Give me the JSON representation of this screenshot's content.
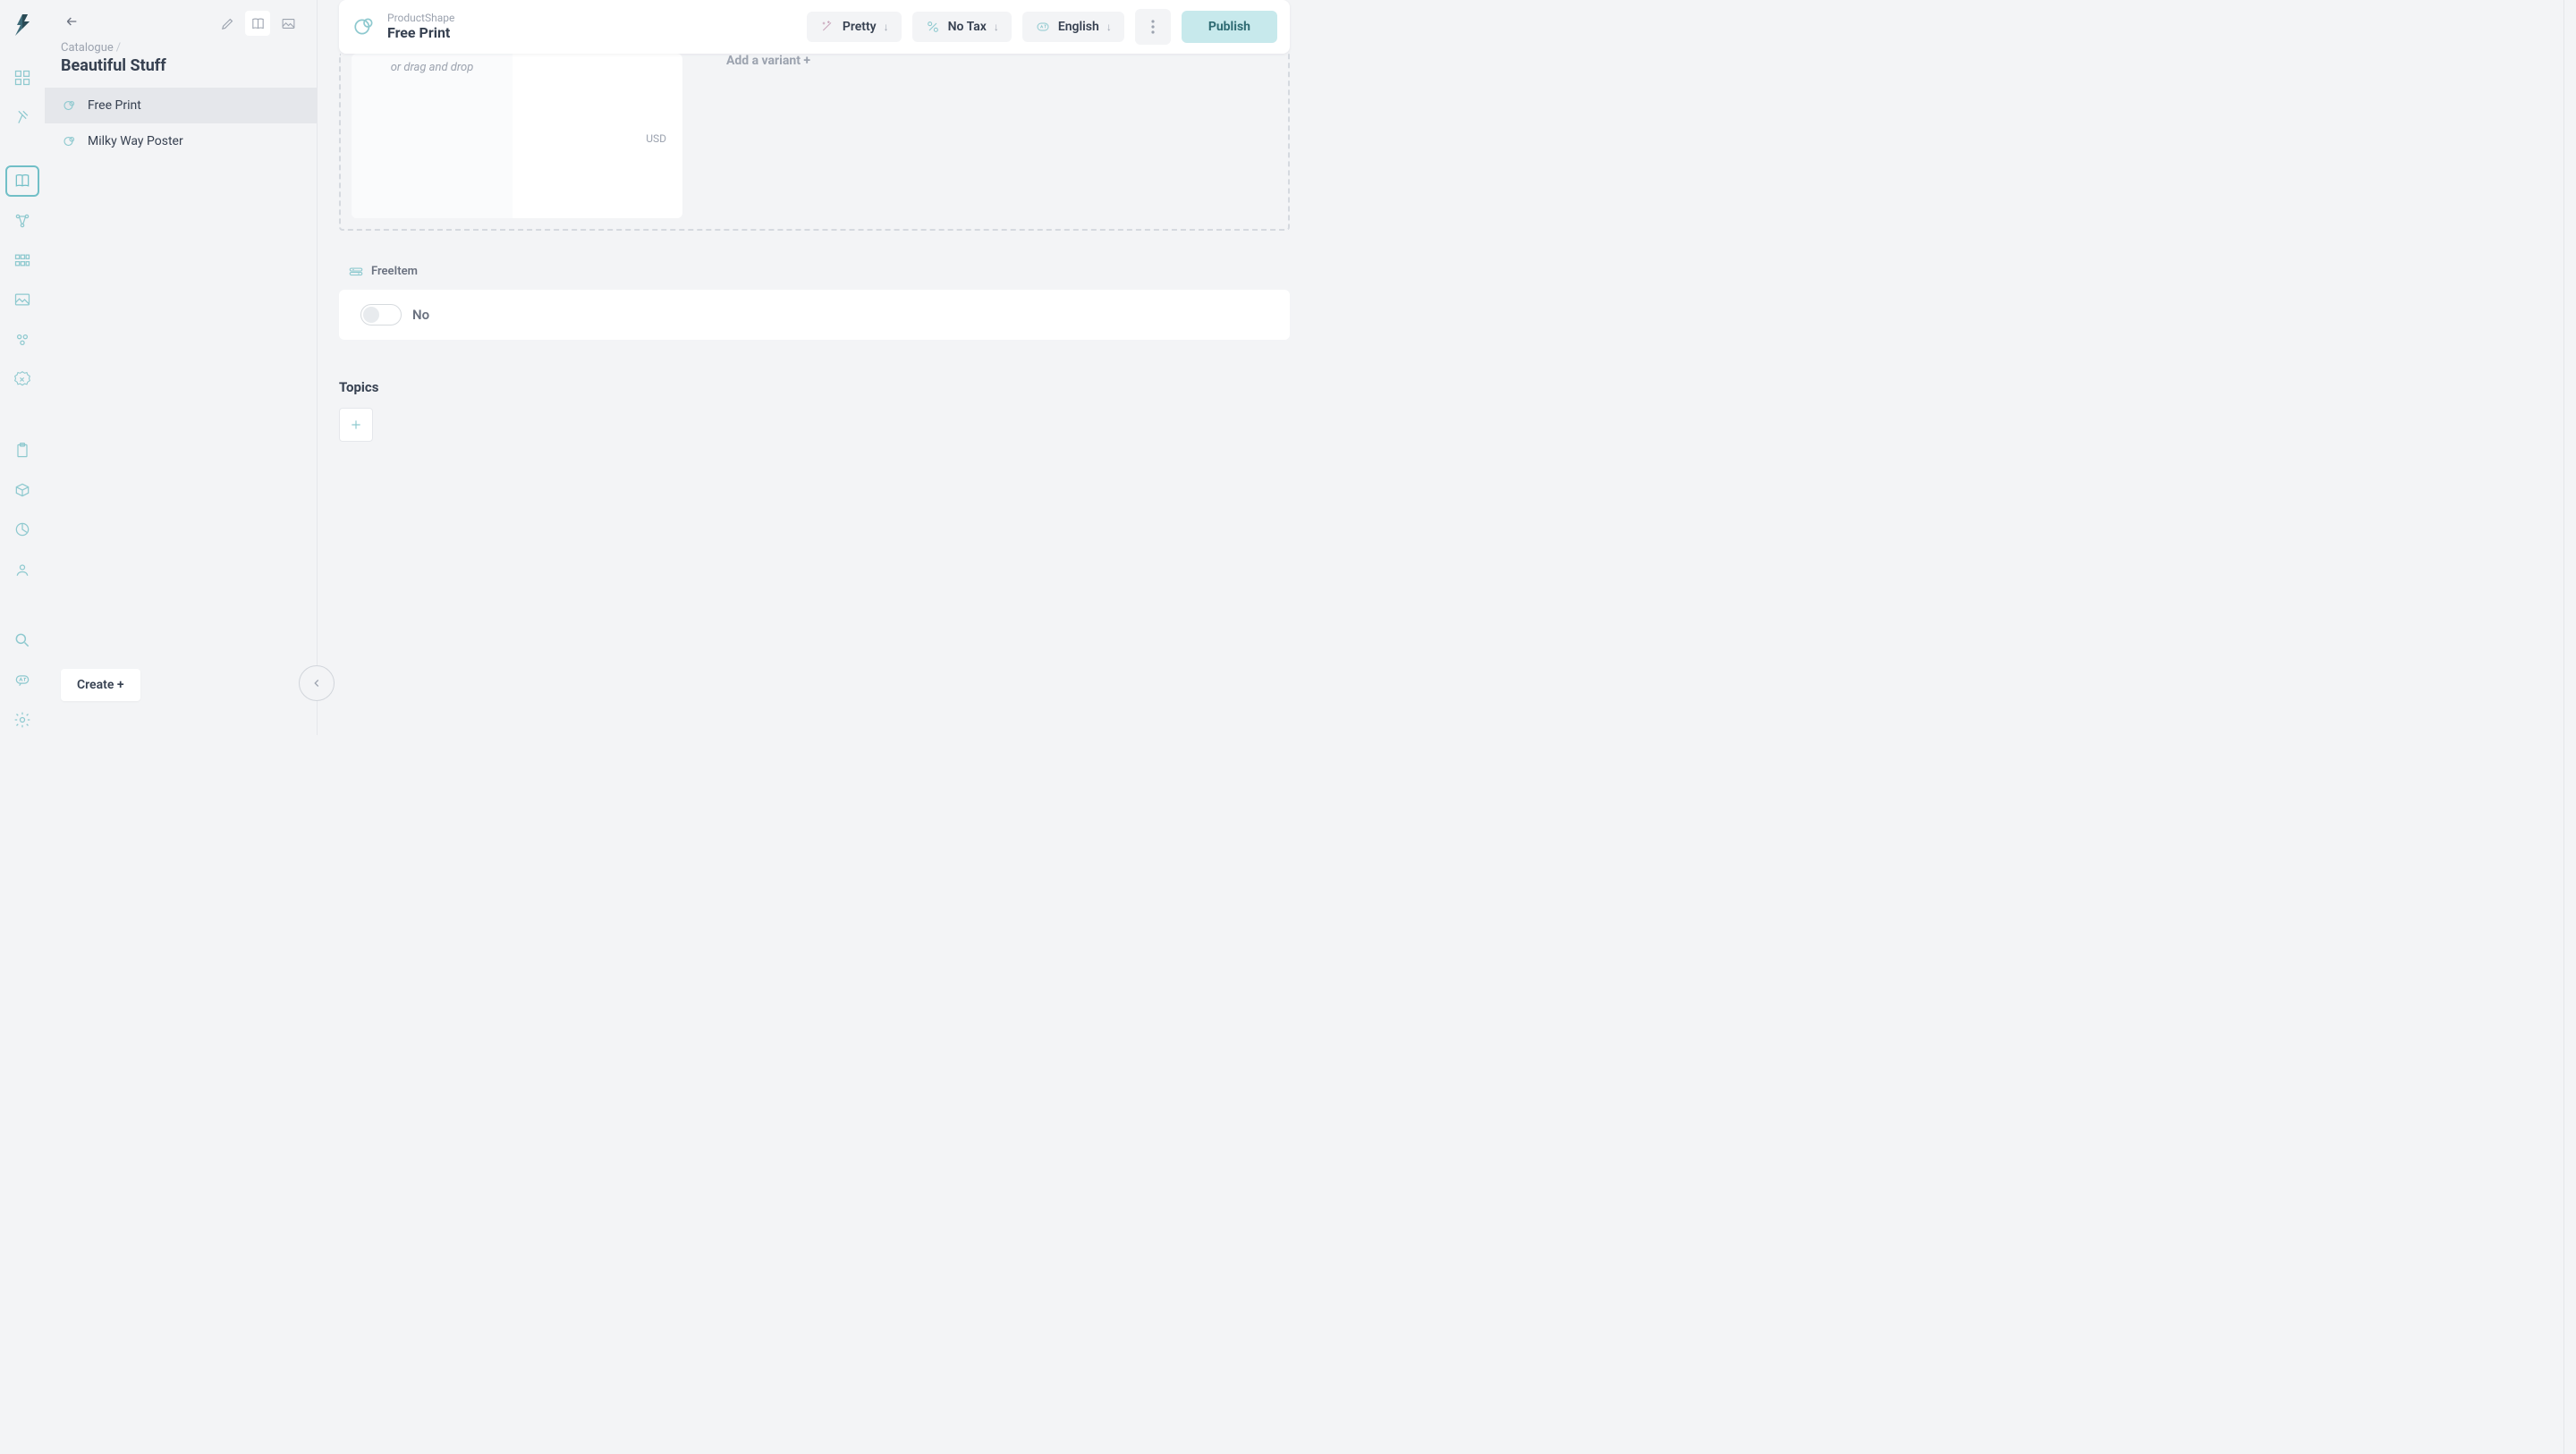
{
  "breadcrumb": {
    "parent": "Catalogue",
    "title": "Beautiful Stuff"
  },
  "products": [
    {
      "name": "Free Print",
      "active": true
    },
    {
      "name": "Milky Way Poster",
      "active": false
    }
  ],
  "create_label": "Create +",
  "topbar": {
    "shape_label": "ProductShape",
    "title": "Free Print",
    "pretty_label": "Pretty",
    "tax_label": "No Tax",
    "lang_label": "English",
    "publish_label": "Publish"
  },
  "image_card": {
    "dragdrop_hint": "or drag and drop",
    "currency": "USD"
  },
  "variant": {
    "add_label": "Add a variant +"
  },
  "freeitem": {
    "section_label": "FreeItem",
    "value_label": "No"
  },
  "topics": {
    "heading": "Topics"
  }
}
